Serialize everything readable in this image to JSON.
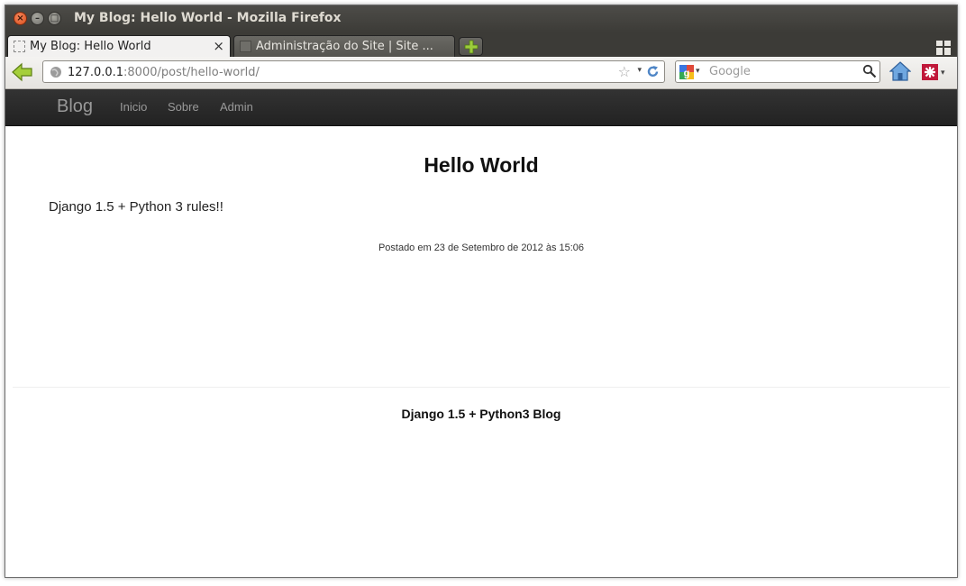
{
  "window": {
    "title": "My Blog: Hello World - Mozilla Firefox",
    "close_glyph": "×",
    "min_glyph": "–",
    "max_glyph": "□"
  },
  "tabs": [
    {
      "label": "My Blog: Hello World",
      "close_glyph": "×",
      "active": true
    },
    {
      "label": "Administração do Site | Site ...",
      "active": false
    }
  ],
  "icons": {
    "back": "back-arrow-icon",
    "globe": "globe-icon",
    "star": "bookmark-star-icon",
    "reload": "reload-icon",
    "search_engine": "google-icon",
    "magnifier": "search-icon",
    "home": "home-icon",
    "addon": "addon-icon",
    "new_tab": "new-tab-plus-icon",
    "tab_groups": "tab-groups-icon"
  },
  "toolbar": {
    "url_host": "127.0.0.1",
    "url_path": ":8000/post/hello-world/",
    "star_glyph": "☆",
    "dropdown_glyph": "▾",
    "search_placeholder": "Google"
  },
  "site": {
    "brand": "Blog",
    "nav": [
      "Inicio",
      "Sobre",
      "Admin"
    ]
  },
  "post": {
    "title": "Hello World",
    "body": "Django 1.5 + Python 3 rules!!",
    "meta": "Postado em 23 de Setembro de 2012 às 15:06"
  },
  "footer": {
    "text": "Django 1.5 + Python3 Blog"
  },
  "colors": {
    "titlebar": "#3c3b37",
    "site_nav": "#222222",
    "nav_text": "#999999",
    "new_tab_plus": "#8bc34a"
  }
}
